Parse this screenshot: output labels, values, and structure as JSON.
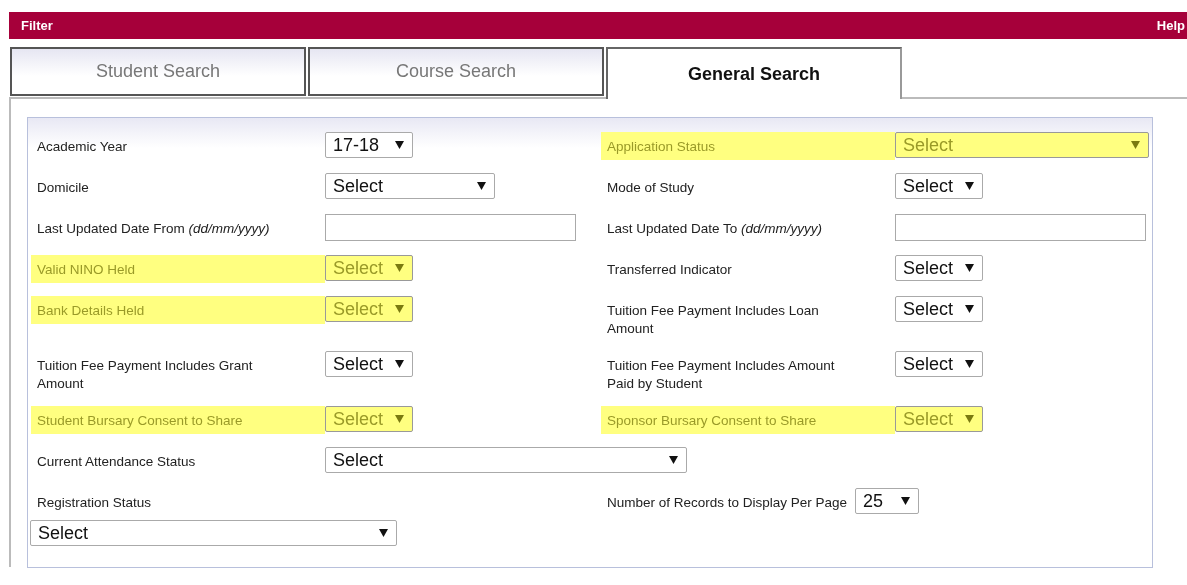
{
  "header": {
    "title": "Filter",
    "help": "Help"
  },
  "tabs": [
    {
      "label": "Student Search",
      "selected": false
    },
    {
      "label": "Course Search",
      "selected": false
    },
    {
      "label": "General Search",
      "selected": true
    }
  ],
  "rows": [
    {
      "fields": [
        {
          "label": "Academic Year",
          "kind": "short",
          "value": "17-18",
          "highlighted": false
        },
        {
          "label": "Application Status",
          "kind": "long",
          "value": "Select",
          "highlighted": true
        }
      ]
    },
    {
      "fields": [
        {
          "label": "Domicile",
          "kind": "medium",
          "value": "Select",
          "highlighted": false
        },
        {
          "label": "Mode of Study",
          "kind": "short",
          "value": "Select",
          "highlighted": false
        }
      ]
    },
    {
      "fields": [
        {
          "label": "Last Updated Date From",
          "hint": "(dd/mm/yyyy)",
          "kind": "text",
          "highlighted": false
        },
        {
          "label": "Last Updated Date To",
          "hint": "(dd/mm/yyyy)",
          "kind": "text",
          "highlighted": false
        }
      ]
    },
    {
      "fields": [
        {
          "label": "Valid NINO Held",
          "kind": "short",
          "value": "Select",
          "highlighted": true
        },
        {
          "label": "Transferred Indicator",
          "kind": "short",
          "value": "Select",
          "highlighted": false
        }
      ]
    },
    {
      "fields": [
        {
          "label": "Bank Details Held",
          "kind": "short",
          "value": "Select",
          "highlighted": true
        },
        {
          "label": "Tuition Fee Payment Includes Loan Amount",
          "kind": "short",
          "value": "Select",
          "highlighted": false
        }
      ]
    },
    {
      "fields": [
        {
          "label": "Tuition Fee Payment Includes Grant Amount",
          "kind": "short",
          "value": "Select",
          "highlighted": false
        },
        {
          "label": "Tuition Fee Payment Includes Amount Paid by Student",
          "kind": "short",
          "value": "Select",
          "highlighted": false
        }
      ]
    },
    {
      "fields": [
        {
          "label": "Student Bursary Consent to Share",
          "kind": "short",
          "value": "Select",
          "highlighted": true
        },
        {
          "label": "Sponsor Bursary Consent to Share",
          "kind": "short",
          "value": "Select",
          "highlighted": true
        }
      ]
    },
    {
      "fields": [
        {
          "label": "Current Attendance Status",
          "kind": "wide",
          "value": "Select",
          "highlighted": false
        }
      ]
    },
    {
      "fields": [
        {
          "label": "Registration Status",
          "kind": "stacked",
          "value": "Select",
          "highlighted": false
        },
        {
          "label": "Number of Records to Display Per Page",
          "kind": "compact",
          "value": "25",
          "highlighted": false
        }
      ]
    }
  ]
}
